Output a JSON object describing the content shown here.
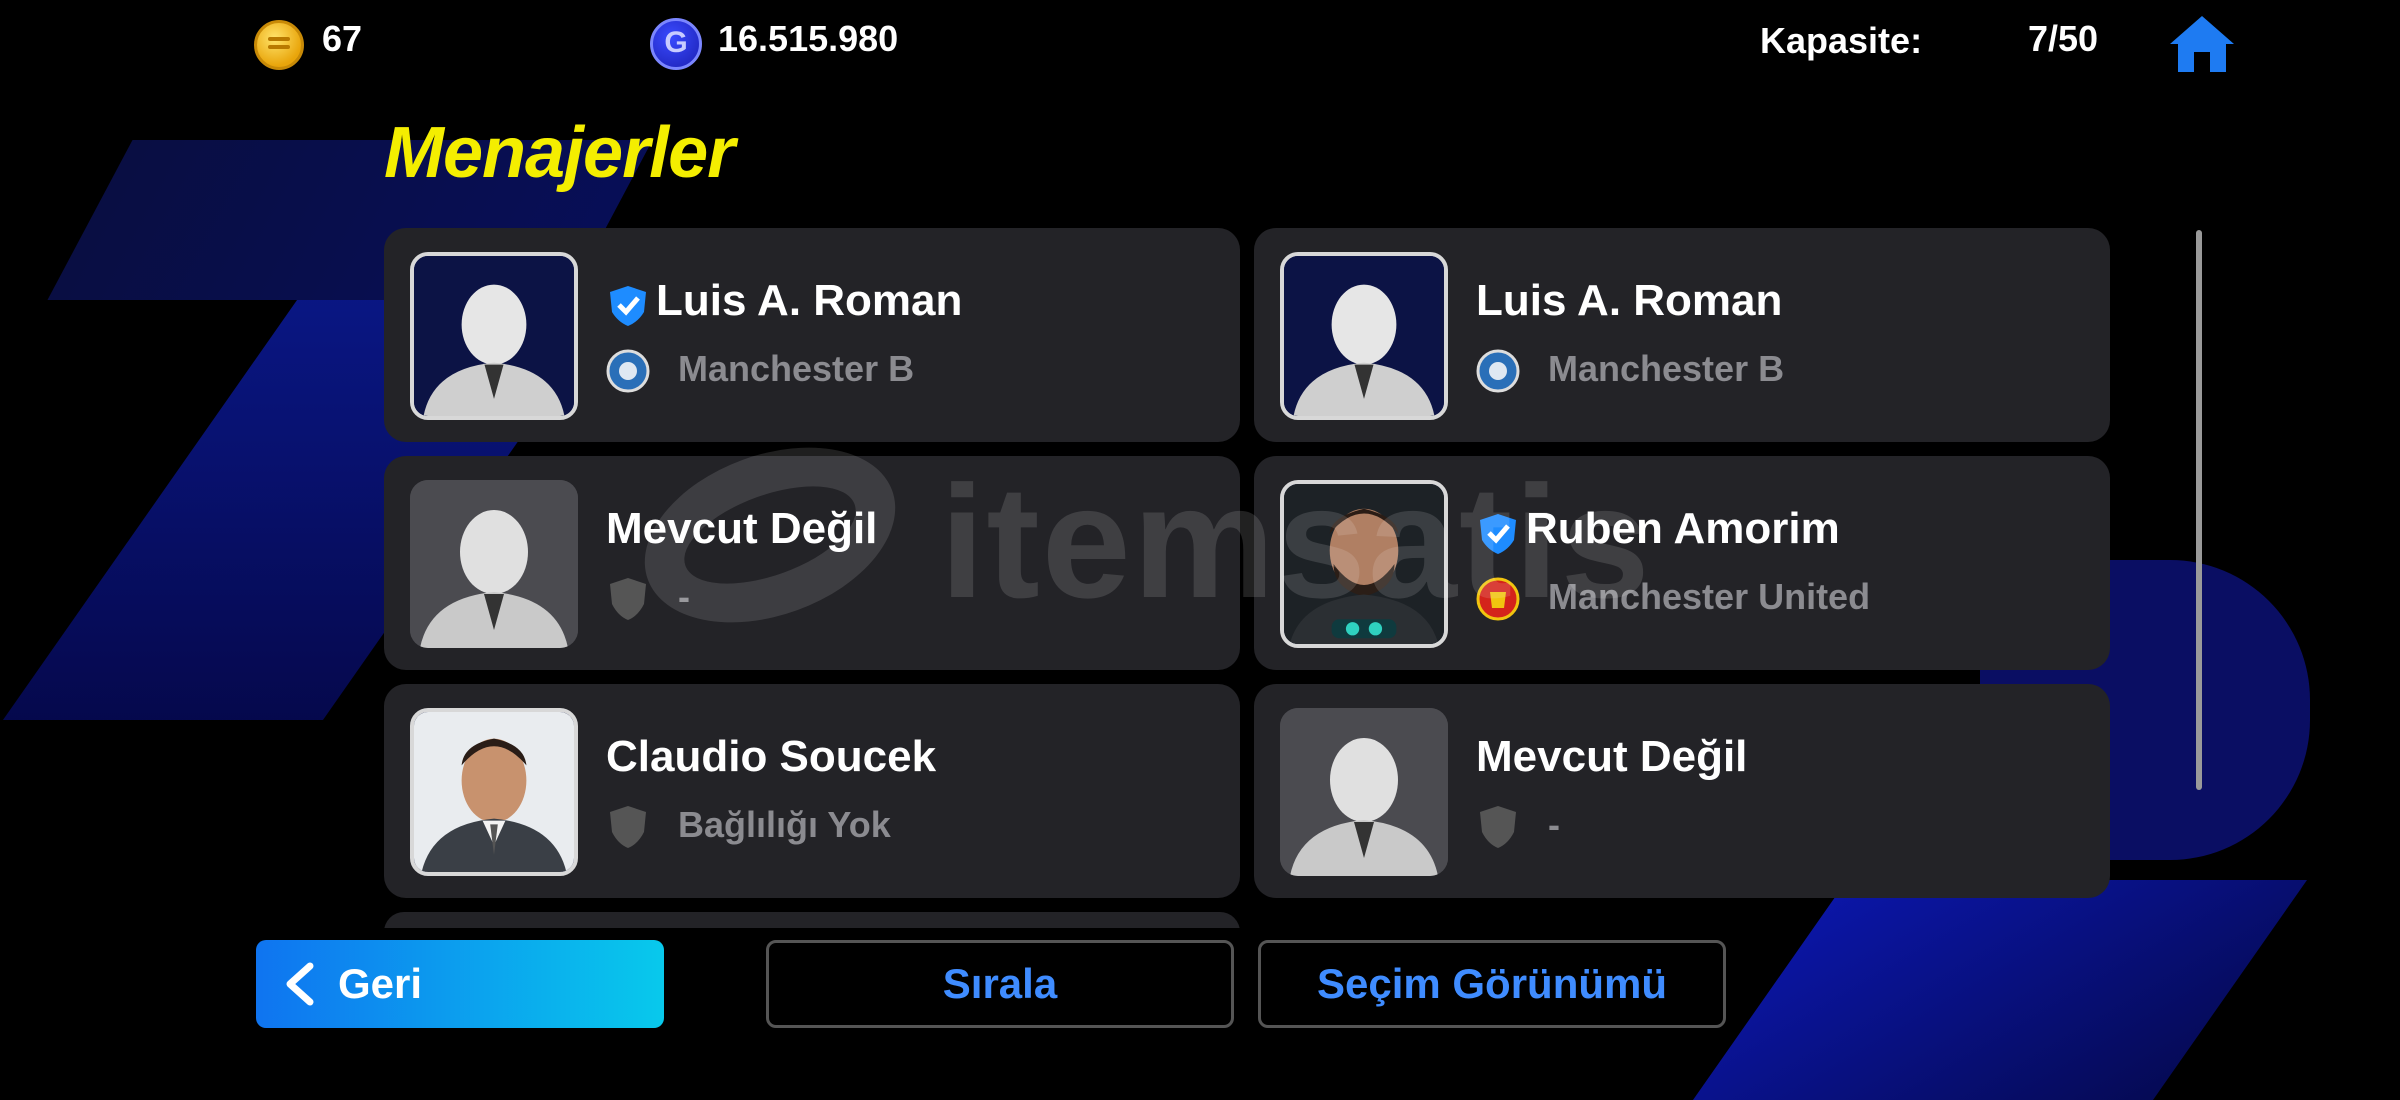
{
  "topbar": {
    "coins": "67",
    "gp": "16.515.980",
    "gp_icon_letter": "G",
    "capacity_label": "Kapasite:",
    "capacity_value": "7/50",
    "home_icon": "home-icon"
  },
  "title": "Menajerler",
  "managers": [
    {
      "name": "Luis A. Roman",
      "club": "Manchester B",
      "verified": true,
      "badge": "club-crest-icon",
      "photo": "silhouette"
    },
    {
      "name": "Luis A. Roman",
      "club": "Manchester B",
      "verified": false,
      "badge": "club-crest-icon",
      "photo": "silhouette"
    },
    {
      "name": "Mevcut Değil",
      "club": "-",
      "verified": false,
      "badge": "shield-icon",
      "photo": "silhouette-grey"
    },
    {
      "name": "Ruben Amorim",
      "club": "Manchester United",
      "verified": true,
      "badge": "man-utd-crest-icon",
      "photo": "portrait"
    },
    {
      "name": "Claudio Soucek",
      "club": "Bağlılığı Yok",
      "verified": false,
      "badge": "shield-icon",
      "photo": "portrait"
    },
    {
      "name": "Mevcut Değil",
      "club": "-",
      "verified": false,
      "badge": "shield-icon",
      "photo": "silhouette-grey"
    }
  ],
  "watermark": "itemsatis",
  "buttons": {
    "back": "Geri",
    "sort": "Sırala",
    "selection_view": "Seçim Görünümü"
  },
  "colors": {
    "title": "#f4ee00",
    "accent_blue": "#3f8cff",
    "card_bg": "#232327"
  }
}
